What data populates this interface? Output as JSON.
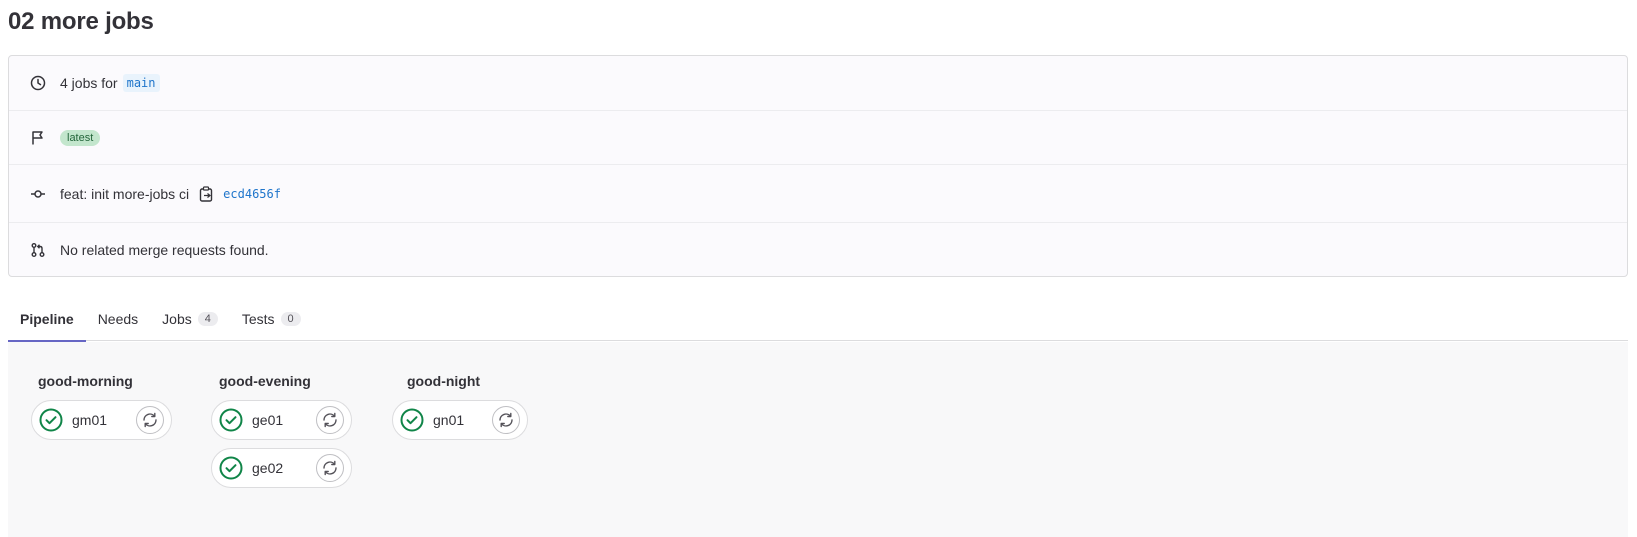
{
  "page": {
    "title": "02 more jobs"
  },
  "info": {
    "jobs_summary": "4 jobs for",
    "ref": "main",
    "badge": "latest",
    "commit_message": "feat: init more-jobs ci",
    "commit_sha": "ecd4656f",
    "merge_requests": "No related merge requests found."
  },
  "tabs": [
    {
      "label": "Pipeline",
      "count": null
    },
    {
      "label": "Needs",
      "count": null
    },
    {
      "label": "Jobs",
      "count": "4"
    },
    {
      "label": "Tests",
      "count": "0"
    }
  ],
  "stages": [
    {
      "name": "good-morning",
      "jobs": [
        {
          "name": "gm01",
          "status": "success"
        }
      ]
    },
    {
      "name": "good-evening",
      "jobs": [
        {
          "name": "ge01",
          "status": "success"
        },
        {
          "name": "ge02",
          "status": "success"
        }
      ]
    },
    {
      "name": "good-night",
      "jobs": [
        {
          "name": "gn01",
          "status": "success"
        }
      ]
    }
  ],
  "colors": {
    "success": "#108548",
    "link": "#1f75cb",
    "tab_active": "#6666c4",
    "badge_bg": "#c3e6cd"
  },
  "icons": {
    "row1": "clock-icon",
    "row2": "flag-icon",
    "row3": "commit-icon",
    "row4": "merge-request-icon",
    "copy": "copy-icon",
    "status": "status-success-icon",
    "retry": "retry-icon"
  }
}
